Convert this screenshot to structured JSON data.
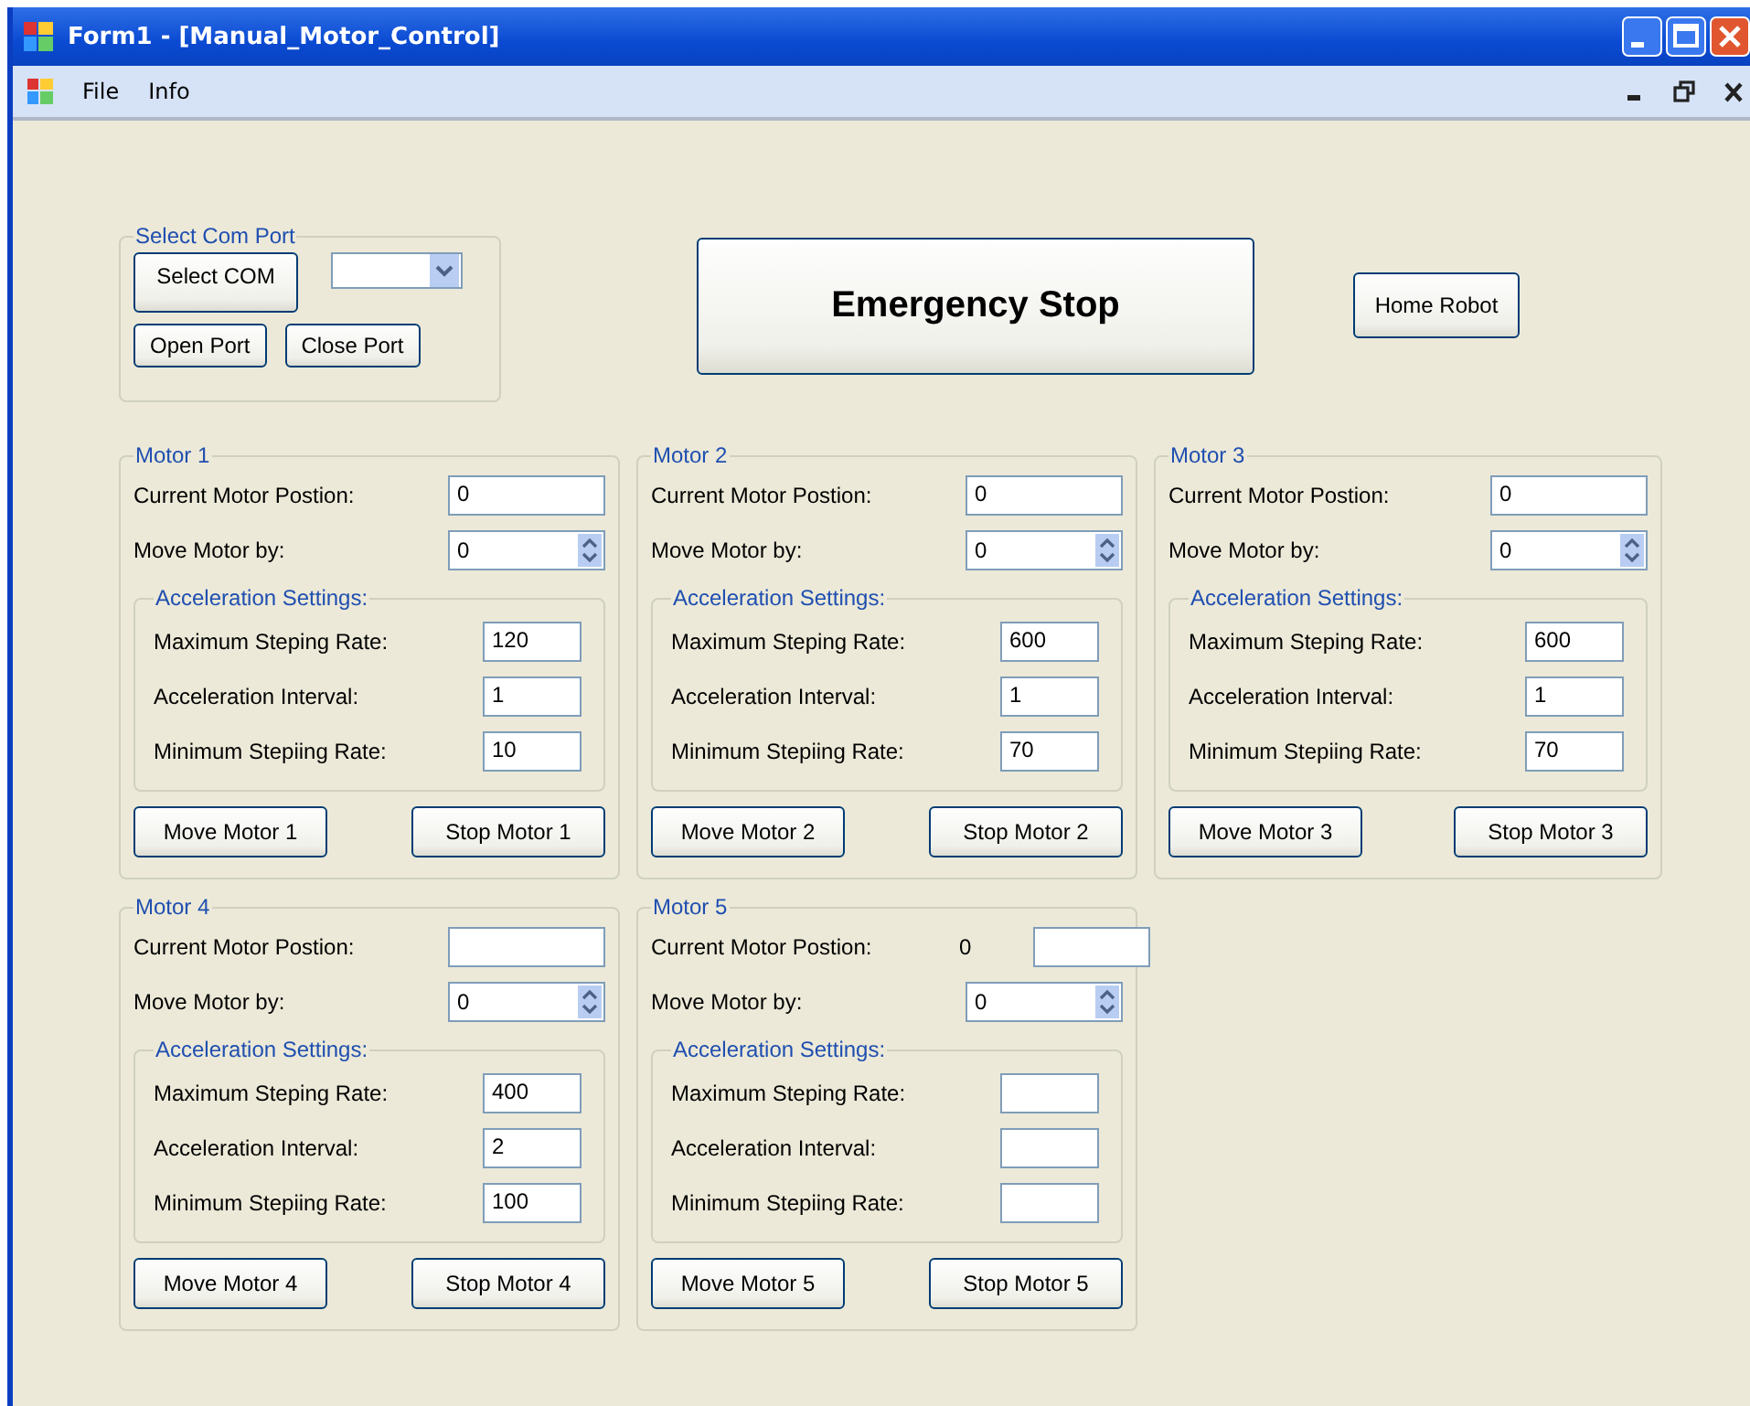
{
  "window": {
    "title": "Form1 - [Manual_Motor_Control]"
  },
  "menu": [
    {
      "label": "File"
    },
    {
      "label": "Info"
    }
  ],
  "com_port": {
    "title": "Select Com Port",
    "select_button": "Select COM",
    "open_button": "Open Port",
    "close_button": "Close Port"
  },
  "emergency_button": "Emergency Stop",
  "home_button": "Home Robot",
  "motors": [
    {
      "title": "Motor 1",
      "position_label": "Current Motor Postion:",
      "position_value": "0",
      "move_label": "Move Motor by:",
      "move_value": "0",
      "accel_title": "Acceleration Settings:",
      "settings": [
        {
          "label": "Maximum Steping Rate:",
          "value": "120"
        },
        {
          "label": "Acceleration Interval:",
          "value": "1"
        },
        {
          "label": "Minimum Stepiing Rate:",
          "value": "10"
        }
      ],
      "move_button": "Move Motor 1",
      "stop_button": "Stop Motor 1"
    },
    {
      "title": "Motor 2",
      "position_label": "Current Motor Postion:",
      "position_value": "0",
      "move_label": "Move Motor by:",
      "move_value": "0",
      "accel_title": "Acceleration Settings:",
      "settings": [
        {
          "label": "Maximum Steping Rate:",
          "value": "600"
        },
        {
          "label": "Acceleration Interval:",
          "value": "1"
        },
        {
          "label": "Minimum Stepiing Rate:",
          "value": "70"
        }
      ],
      "move_button": "Move Motor 2",
      "stop_button": "Stop Motor 2"
    },
    {
      "title": "Motor 3",
      "position_label": "Current Motor Postion:",
      "position_value": "0",
      "move_label": "Move Motor by:",
      "move_value": "0",
      "accel_title": "Acceleration Settings:",
      "settings": [
        {
          "label": "Maximum Steping Rate:",
          "value": "600"
        },
        {
          "label": "Acceleration Interval:",
          "value": "1"
        },
        {
          "label": "Minimum Stepiing Rate:",
          "value": "70"
        }
      ],
      "move_button": "Move Motor 3",
      "stop_button": "Stop Motor 3"
    },
    {
      "title": "Motor 4",
      "position_label": "Current Motor Postion:",
      "move_label": "Move Motor by:",
      "move_value": "0",
      "accel_title": "Acceleration Settings:",
      "settings": [
        {
          "label": "Maximum Steping Rate:",
          "value": "400"
        },
        {
          "label": "Acceleration Interval:",
          "value": "2"
        },
        {
          "label": "Minimum Stepiing Rate:",
          "value": "100"
        }
      ],
      "move_button": "Move Motor 4",
      "stop_button": "Stop Motor 4"
    },
    {
      "title": "Motor 5",
      "position_label": "Current Motor Postion:",
      "position_readout": "0",
      "move_label": "Move Motor by:",
      "move_value": "0",
      "accel_title": "Acceleration Settings:",
      "settings": [
        {
          "label": "Maximum Steping Rate:"
        },
        {
          "label": "Acceleration Interval:"
        },
        {
          "label": "Minimum Stepiing Rate:"
        }
      ],
      "move_button": "Move Motor 5",
      "stop_button": "Stop Motor 5"
    }
  ]
}
